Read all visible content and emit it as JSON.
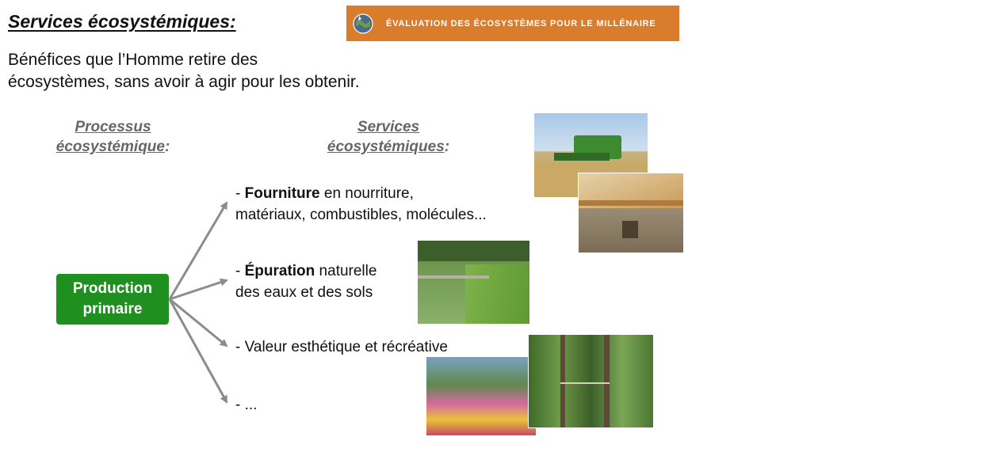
{
  "slide": {
    "title": "Services écosystémiques",
    "title_suffix": ":",
    "intro_line1": "Bénéfices que l’Homme retire des",
    "intro_line2": "écosystèmes, sans avoir à agir pour les obtenir."
  },
  "banner": {
    "text": "ÉVALUATION DES ÉCOSYSTÈMES POUR LE MILLÉNAIRE"
  },
  "columns": {
    "process_line1": "Processus",
    "process_line2": "écosystémique",
    "services_line1": "Services",
    "services_line2": "écosystémiques",
    "colon": ":"
  },
  "process": {
    "line1": "Production",
    "line2": "primaire"
  },
  "services": [
    {
      "prefix": "- ",
      "bold": "Fourniture",
      "rest": " en nourriture,",
      "line2": "matériaux, combustibles, molécules..."
    },
    {
      "prefix": "- ",
      "bold": "Épuration",
      "rest": " naturelle",
      "line2": "des eaux et des sols"
    },
    {
      "prefix": "- ",
      "bold": "",
      "rest": "Valeur esthétique et récréative",
      "line2": ""
    },
    {
      "prefix": "- ",
      "bold": "",
      "rest": "...",
      "line2": ""
    }
  ],
  "colors": {
    "banner": "#d97c2b",
    "process_box": "#1f8f1f",
    "arrow": "#8c8c8c",
    "heading": "#666666"
  },
  "icons": [
    "globe-logo-icon",
    "arrow-icon"
  ]
}
